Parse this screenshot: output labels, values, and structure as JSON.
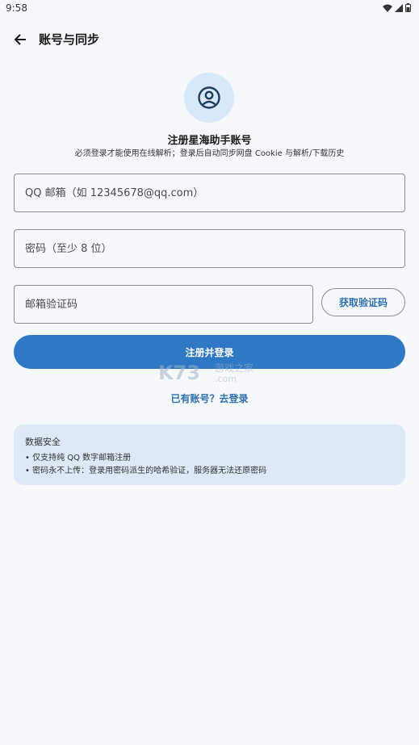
{
  "status_bar": {
    "time": "9:58"
  },
  "app_bar": {
    "title": "账号与同步"
  },
  "header": {
    "title": "注册星海助手账号",
    "subtitle": "必须登录才能使用在线解析；登录后自动同步网盘 Cookie 与解析/下载历史"
  },
  "form": {
    "email_placeholder": "QQ 邮箱（如 12345678@qq.com）",
    "password_placeholder": "密码（至少 8 位）",
    "code_placeholder": "邮箱验证码",
    "get_code_label": "获取验证码",
    "submit_label": "注册并登录",
    "login_link": "已有账号？去登录"
  },
  "watermark": {
    "text_main": "K73",
    "text_cn": "游戏之家",
    "text_domain": ".com"
  },
  "security": {
    "title": "数据安全",
    "lines": [
      "• 仅支持纯 QQ 数字邮箱注册",
      "• 密码永不上传：登录用密码派生的哈希验证，服务器无法还原密码"
    ]
  },
  "colors": {
    "primary": "#2f78c5",
    "link": "#2f6fae",
    "card": "#dde9f6",
    "background": "#f6f9fc"
  }
}
